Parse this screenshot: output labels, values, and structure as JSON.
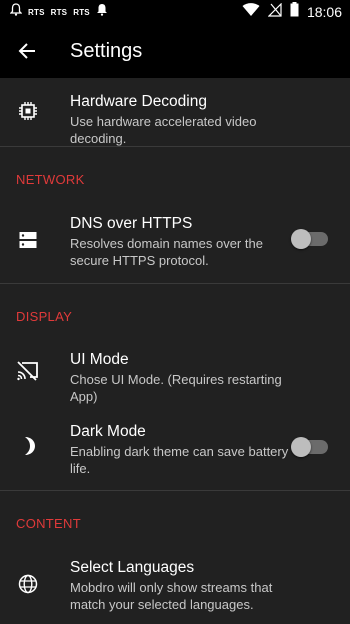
{
  "status_bar": {
    "time": "18:06",
    "notifications": [
      "RTS",
      "RTS",
      "RTS"
    ]
  },
  "app_bar": {
    "title": "Settings",
    "back_icon": "arrow-left-icon"
  },
  "items": [
    {
      "title": "Hardware Decoding",
      "subtitle": "Use hardware accelerated video decoding.",
      "icon": "chip-icon"
    }
  ],
  "sections": {
    "network": {
      "header": "NETWORK",
      "dns": {
        "title": "DNS over HTTPS",
        "subtitle": "Resolves domain names over the secure HTTPS protocol.",
        "toggle": false,
        "icon": "dns-icon"
      }
    },
    "display": {
      "header": "DISPLAY",
      "ui_mode": {
        "title": "UI Mode",
        "subtitle": "Chose UI Mode. (Requires restarting App)",
        "icon": "cast-off-icon"
      },
      "dark_mode": {
        "title": "Dark Mode",
        "subtitle": "Enabling dark theme can save battery life.",
        "toggle": false,
        "icon": "moon-icon"
      }
    },
    "content": {
      "header": "CONTENT",
      "languages": {
        "title": "Select Languages",
        "subtitle": "Mobdro will only show streams that match your selected languages.",
        "icon": "globe-icon"
      }
    }
  },
  "colors": {
    "background": "#212121",
    "bar": "#000000",
    "accent": "#e03a3a"
  }
}
